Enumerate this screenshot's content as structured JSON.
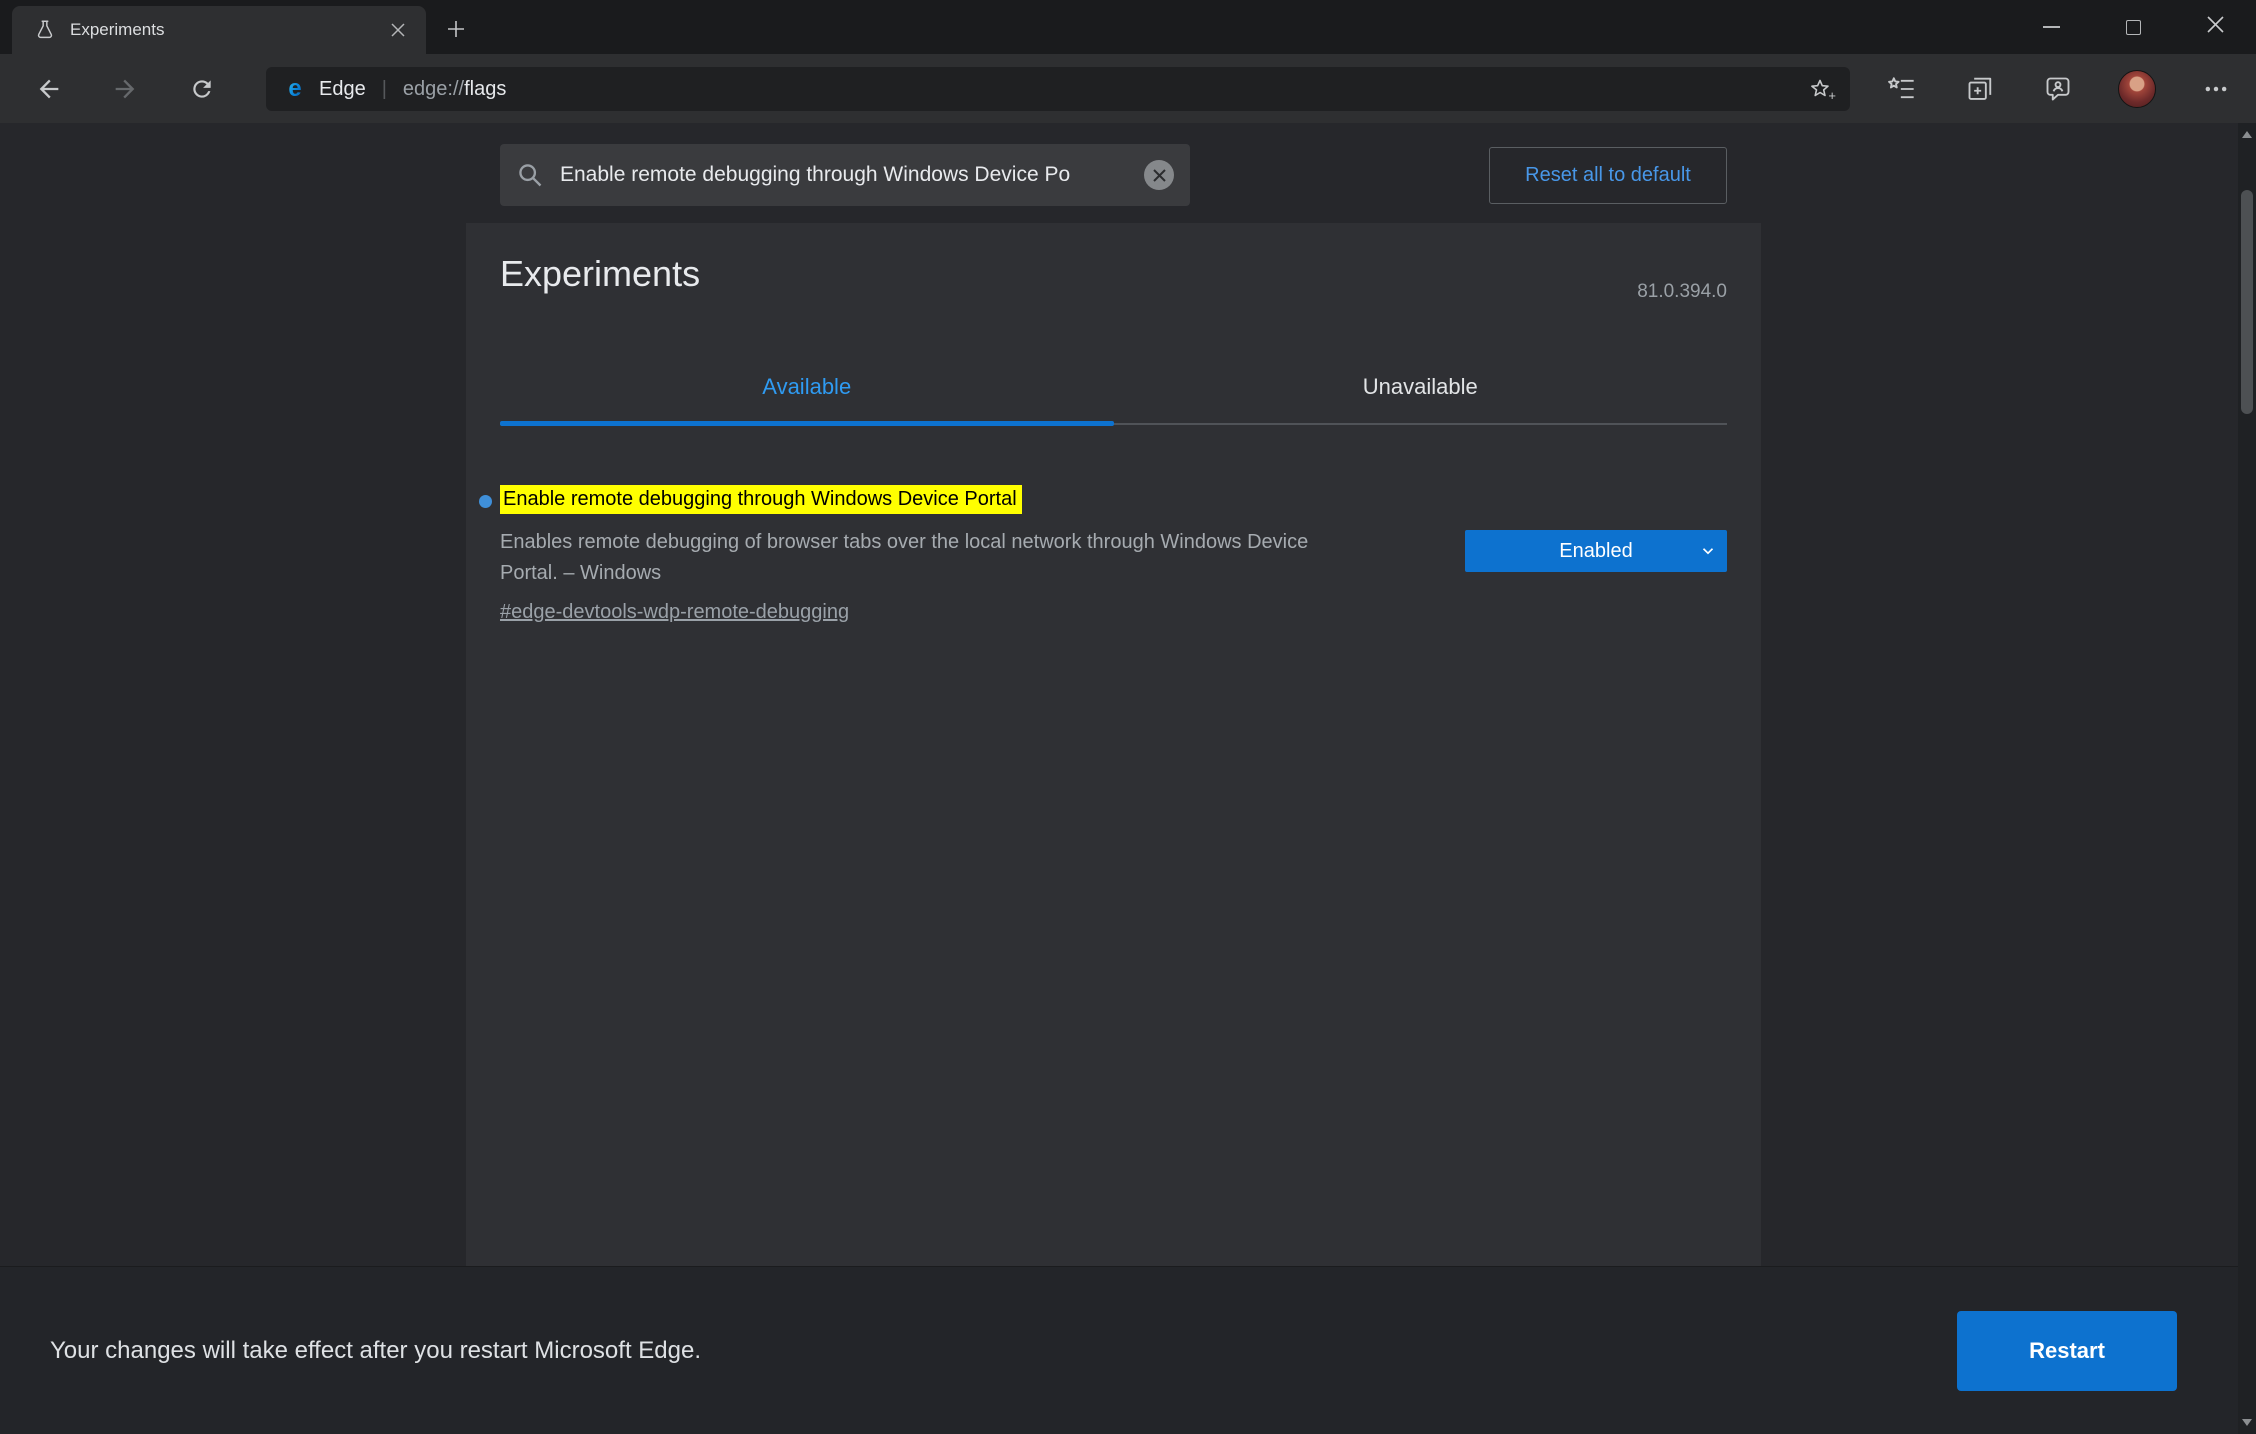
{
  "browser": {
    "tab_title": "Experiments",
    "brand": "Edge",
    "url_scheme": "edge://",
    "url_path": "flags"
  },
  "search": {
    "value": "Enable remote debugging through Windows Device Po"
  },
  "actions": {
    "reset_all": "Reset all to default",
    "restart": "Restart"
  },
  "page": {
    "title": "Experiments",
    "version": "81.0.394.0",
    "tab_available": "Available",
    "tab_unavailable": "Unavailable"
  },
  "flag": {
    "name": "Enable remote debugging through Windows Device Portal",
    "description": "Enables remote debugging of browser tabs over the local network through Windows Device Portal. – Windows",
    "permalink": "#edge-devtools-wdp-remote-debugging",
    "value": "Enabled"
  },
  "footer": {
    "message": "Your changes will take effect after you restart Microsoft Edge."
  },
  "colors": {
    "accent_blue": "#0d72cf",
    "tab_active_blue": "#2f9bf2",
    "link_blue": "#4897e8",
    "highlight_yellow": "#ffff00",
    "flag_bullet_blue": "#3f8fd9"
  }
}
